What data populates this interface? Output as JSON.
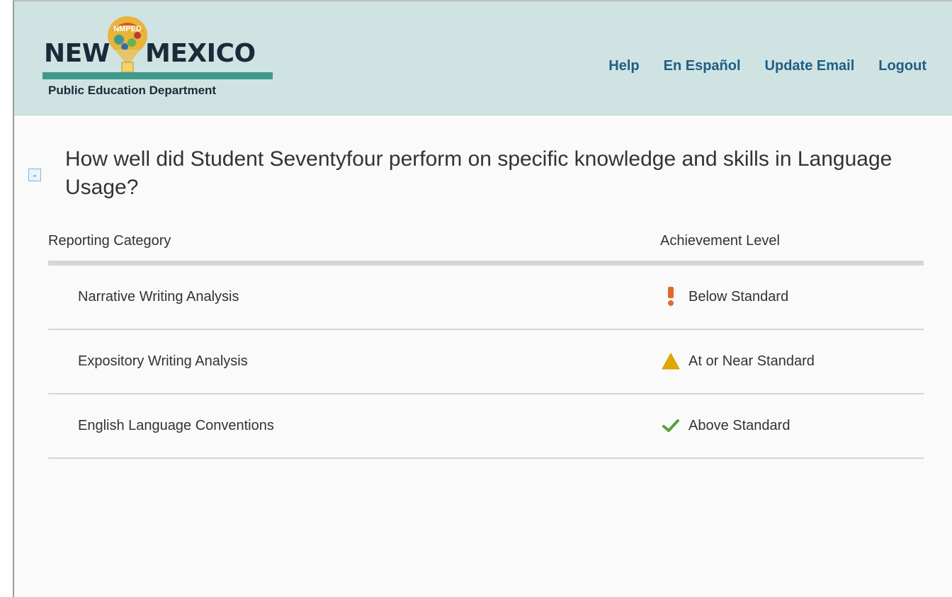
{
  "header": {
    "logo": {
      "left_text": "NEW",
      "right_text": "MEXICO",
      "subtitle": "Public Education Department",
      "balloon_text": "NMPED"
    },
    "nav": [
      "Help",
      "En Español",
      "Update Email",
      "Logout"
    ]
  },
  "section": {
    "collapse_symbol": "-",
    "question": "How well did Student Seventyfour perform on specific knowledge and skills in Language Usage?"
  },
  "table": {
    "headers": {
      "category": "Reporting Category",
      "level": "Achievement Level"
    },
    "rows": [
      {
        "category": "Narrative Writing Analysis",
        "level": "Below Standard",
        "icon": "exclamation-icon",
        "color": "#e06a2c"
      },
      {
        "category": "Expository Writing Analysis",
        "level": "At or Near Standard",
        "icon": "warning-triangle-icon",
        "color": "#e0a800"
      },
      {
        "category": "English Language Conventions",
        "level": "Above Standard",
        "icon": "checkmark-icon",
        "color": "#5aa13a"
      }
    ]
  },
  "colors": {
    "header_bg": "#cfe3e2",
    "nav_link": "#1f5d86",
    "logo_bar": "#3f9a8e"
  }
}
